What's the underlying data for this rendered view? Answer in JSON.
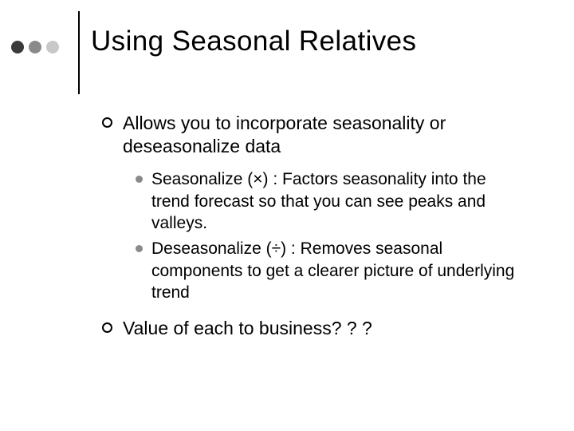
{
  "title": "Using Seasonal Relatives",
  "bullets": {
    "b1": "Allows you to incorporate seasonality or deseasonalize data",
    "sub1": "Seasonalize (×) : Factors seasonality into the trend forecast so that you can see peaks and valleys.",
    "sub2": "Deseasonalize (÷) : Removes seasonal components to get a clearer picture of underlying trend",
    "b2": "Value of each to business? ? ?"
  }
}
